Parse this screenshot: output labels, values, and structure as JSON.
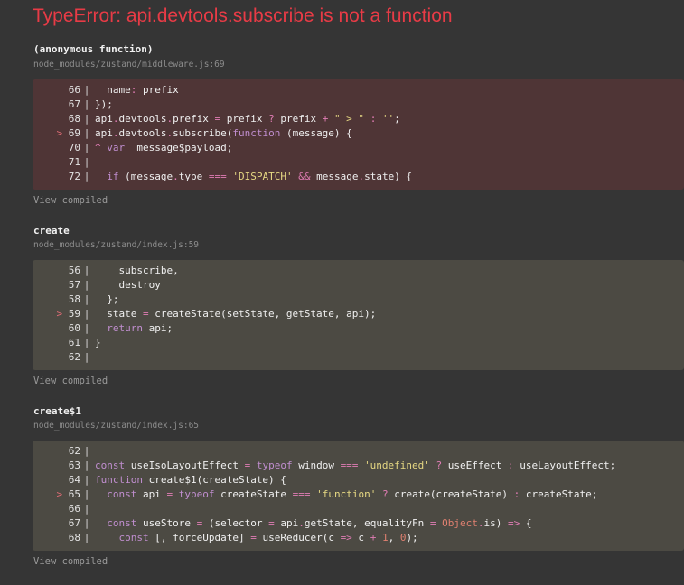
{
  "error": {
    "title": "TypeError: api.devtools.subscribe is not a function"
  },
  "frames": [
    {
      "name": "(anonymous function)",
      "file": "node_modules/zustand/middleware.js:69",
      "view_compiled": "View compiled",
      "lines": [
        {
          "no": "66",
          "text": "  name: prefix"
        },
        {
          "no": "67",
          "text": "});"
        },
        {
          "no": "68",
          "text": "api.devtools.prefix = prefix ? prefix + \" > \" : '';"
        },
        {
          "no": "69",
          "text": "api.devtools.subscribe(function (message) {",
          "highlight": true
        },
        {
          "no": "70",
          "text": "^ var _message$payload;"
        },
        {
          "no": "71",
          "text": ""
        },
        {
          "no": "72",
          "text": "  if (message.type === 'DISPATCH' && message.state) {"
        }
      ]
    },
    {
      "name": "create",
      "file": "node_modules/zustand/index.js:59",
      "view_compiled": "View compiled",
      "lines": [
        {
          "no": "56",
          "text": "    subscribe,"
        },
        {
          "no": "57",
          "text": "    destroy"
        },
        {
          "no": "58",
          "text": "  };"
        },
        {
          "no": "59",
          "text": "  state = createState(setState, getState, api);",
          "highlight": true
        },
        {
          "no": "60",
          "text": "  return api;"
        },
        {
          "no": "61",
          "text": "}"
        },
        {
          "no": "62",
          "text": ""
        }
      ]
    },
    {
      "name": "create$1",
      "file": "node_modules/zustand/index.js:65",
      "view_compiled": "View compiled",
      "lines": [
        {
          "no": "62",
          "text": ""
        },
        {
          "no": "63",
          "text": "const useIsoLayoutEffect = typeof window === 'undefined' ? useEffect : useLayoutEffect;"
        },
        {
          "no": "64",
          "text": "function create$1(createState) {"
        },
        {
          "no": "65",
          "text": "  const api = typeof createState === 'function' ? create(createState) : createState;",
          "highlight": true
        },
        {
          "no": "66",
          "text": ""
        },
        {
          "no": "67",
          "text": "  const useStore = (selector = api.getState, equalityFn = Object.is) => {"
        },
        {
          "no": "68",
          "text": "    const [, forceUpdate] = useReducer(c => c + 1, 0);"
        }
      ]
    }
  ],
  "colors": {
    "error_red": "#e83b46",
    "background": "#353535",
    "error_box": "#4f3536",
    "code_box": "#4c4a43"
  }
}
